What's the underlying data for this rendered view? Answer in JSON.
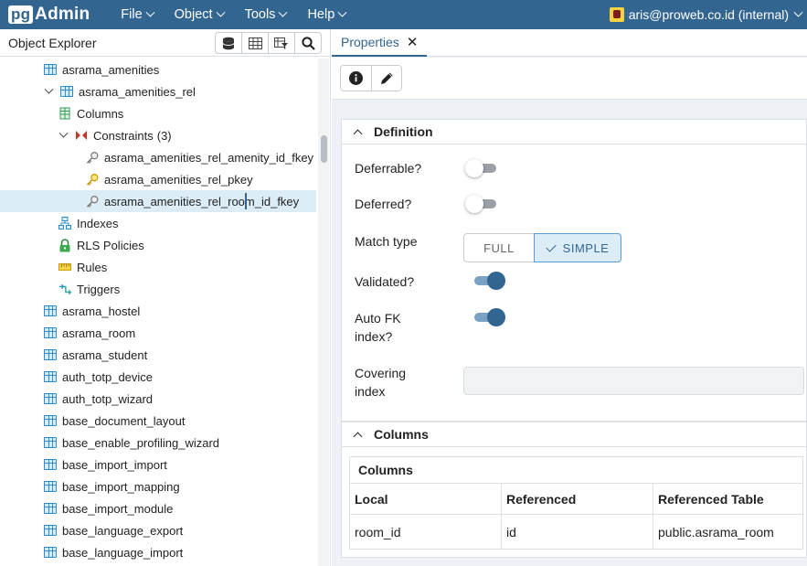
{
  "nav": {
    "logo_prefix": "pg",
    "logo_suffix": "Admin",
    "menu": [
      {
        "label": "File"
      },
      {
        "label": "Object"
      },
      {
        "label": "Tools"
      },
      {
        "label": "Help"
      }
    ],
    "user": "aris@proweb.co.id (internal)"
  },
  "object_explorer": {
    "title": "Object Explorer",
    "tools": [
      "database-icon",
      "table-view-icon",
      "filter-rows-icon",
      "search-icon"
    ],
    "tree": [
      {
        "label": "asrama_amenities",
        "level": 0,
        "arrow": "right",
        "icon": "table-icon"
      },
      {
        "label": "asrama_amenities_rel",
        "level": 0,
        "arrow": "down",
        "icon": "table-icon"
      },
      {
        "label": "Columns",
        "level": 1,
        "arrow": "right",
        "icon": "columns-icon"
      },
      {
        "label": "Constraints",
        "count": "(3)",
        "level": 1,
        "arrow": "down",
        "icon": "constraints-icon"
      },
      {
        "label": "asrama_amenities_rel_amenity_id_fkey",
        "level": 2,
        "arrow": "none",
        "icon": "foreign-key-icon"
      },
      {
        "label": "asrama_amenities_rel_pkey",
        "level": 2,
        "arrow": "none",
        "icon": "primary-key-icon"
      },
      {
        "label": "asrama_amenities_rel_room_id_fkey",
        "level": 2,
        "arrow": "none",
        "icon": "foreign-key-icon",
        "selected": true
      },
      {
        "label": "Indexes",
        "level": 1,
        "arrow": "right",
        "icon": "indexes-icon"
      },
      {
        "label": "RLS Policies",
        "level": 1,
        "arrow": "right",
        "icon": "lock-icon"
      },
      {
        "label": "Rules",
        "level": 1,
        "arrow": "right",
        "icon": "rules-icon"
      },
      {
        "label": "Triggers",
        "level": 1,
        "arrow": "right",
        "icon": "triggers-icon"
      },
      {
        "label": "asrama_hostel",
        "level": 0,
        "arrow": "right",
        "icon": "table-icon"
      },
      {
        "label": "asrama_room",
        "level": 0,
        "arrow": "right",
        "icon": "table-icon"
      },
      {
        "label": "asrama_student",
        "level": 0,
        "arrow": "right",
        "icon": "table-icon"
      },
      {
        "label": "auth_totp_device",
        "level": 0,
        "arrow": "right",
        "icon": "table-icon"
      },
      {
        "label": "auth_totp_wizard",
        "level": 0,
        "arrow": "right",
        "icon": "table-icon"
      },
      {
        "label": "base_document_layout",
        "level": 0,
        "arrow": "right",
        "icon": "table-icon"
      },
      {
        "label": "base_enable_profiling_wizard",
        "level": 0,
        "arrow": "right",
        "icon": "table-icon"
      },
      {
        "label": "base_import_import",
        "level": 0,
        "arrow": "right",
        "icon": "table-icon"
      },
      {
        "label": "base_import_mapping",
        "level": 0,
        "arrow": "right",
        "icon": "table-icon"
      },
      {
        "label": "base_import_module",
        "level": 0,
        "arrow": "right",
        "icon": "table-icon"
      },
      {
        "label": "base_language_export",
        "level": 0,
        "arrow": "right",
        "icon": "table-icon"
      },
      {
        "label": "base_language_import",
        "level": 0,
        "arrow": "right",
        "icon": "table-icon"
      }
    ]
  },
  "properties": {
    "tab_label": "Properties",
    "toolbar": [
      "info-icon",
      "edit-icon"
    ],
    "definition": {
      "title": "Definition",
      "deferrable_label": "Deferrable?",
      "deferrable": false,
      "deferred_label": "Deferred?",
      "deferred": false,
      "match_type_label": "Match type",
      "match_options": [
        "FULL",
        "SIMPLE"
      ],
      "match_selected": "SIMPLE",
      "validated_label": "Validated?",
      "validated": true,
      "auto_fk_label_1": "Auto FK",
      "auto_fk_label_2": "index?",
      "auto_fk": true,
      "covering_label_1": "Covering",
      "covering_label_2": "index",
      "covering_value": ""
    },
    "columns": {
      "title": "Columns",
      "table_title": "Columns",
      "headers": [
        "Local",
        "Referenced",
        "Referenced Table"
      ],
      "rows": [
        [
          "room_id",
          "id",
          "public.asrama_room"
        ]
      ]
    }
  }
}
